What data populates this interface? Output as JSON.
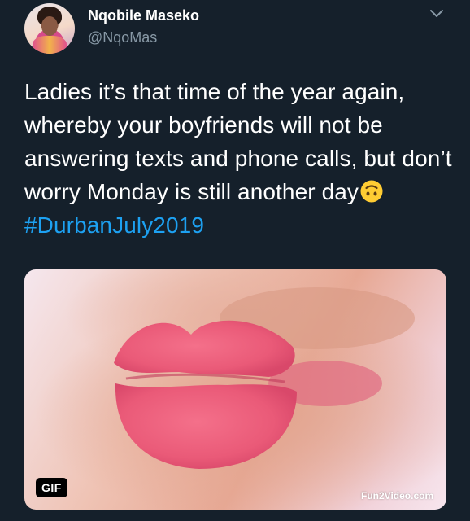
{
  "author": {
    "display_name": "Nqobile Maseko",
    "handle": "@NqoMas"
  },
  "icons": {
    "more": "chevron-down-icon",
    "emoji": "upside-down-face-emoji-icon"
  },
  "tweet": {
    "text_before_emoji": "Ladies it’s that time of the year again, whereby your boyfriends will not be answering texts and phone calls, but don’t worry Monday is still another day",
    "hashtag": "#DurbanJuly2019"
  },
  "media": {
    "badge": "GIF",
    "watermark": "Fun2Video.com"
  },
  "colors": {
    "background": "#15202b",
    "hashtag": "#1da1f2",
    "secondary_text": "#8899a6"
  }
}
